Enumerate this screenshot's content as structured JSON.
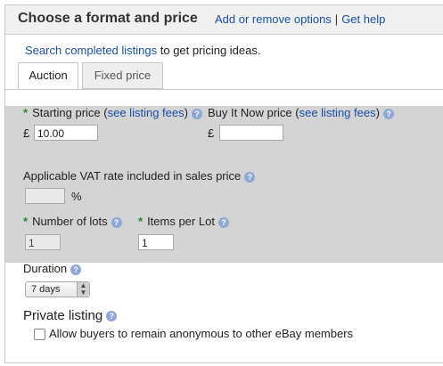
{
  "header": {
    "title": "Choose a format and price",
    "link_add_remove": "Add or remove options",
    "separator": "|",
    "link_help": "Get help"
  },
  "intro": {
    "link": "Search completed listings",
    "text": " to get pricing ideas."
  },
  "tabs": [
    {
      "label": "Auction",
      "active": true
    },
    {
      "label": "Fixed price",
      "active": false
    }
  ],
  "form": {
    "starting_price_label": "Starting price (",
    "starting_price_link": "see listing fees",
    "starting_price_close": ")",
    "bin_label": "Buy It Now price (",
    "bin_link": "see listing fees",
    "bin_close": ")",
    "currency": "£",
    "starting_price_value": "10.00",
    "bin_value": "",
    "vat_label": "Applicable VAT rate included in sales price",
    "vat_value": "",
    "percent": "%",
    "lots_label": "Number of lots",
    "lots_value": "1",
    "items_label": "Items per Lot",
    "items_value": "1",
    "duration_label": "Duration",
    "duration_value": "7 days",
    "private_label": "Private listing",
    "private_checkbox_label": "Allow buyers to remain anonymous to other eBay members",
    "private_checked": false
  },
  "icons": {
    "help": "help-icon",
    "required": "required-star-icon"
  },
  "colors": {
    "link": "#1a4fa6",
    "required_star": "#2a8a2a",
    "help_icon": "#8ea6d8",
    "panel": "#d4d4d4"
  }
}
